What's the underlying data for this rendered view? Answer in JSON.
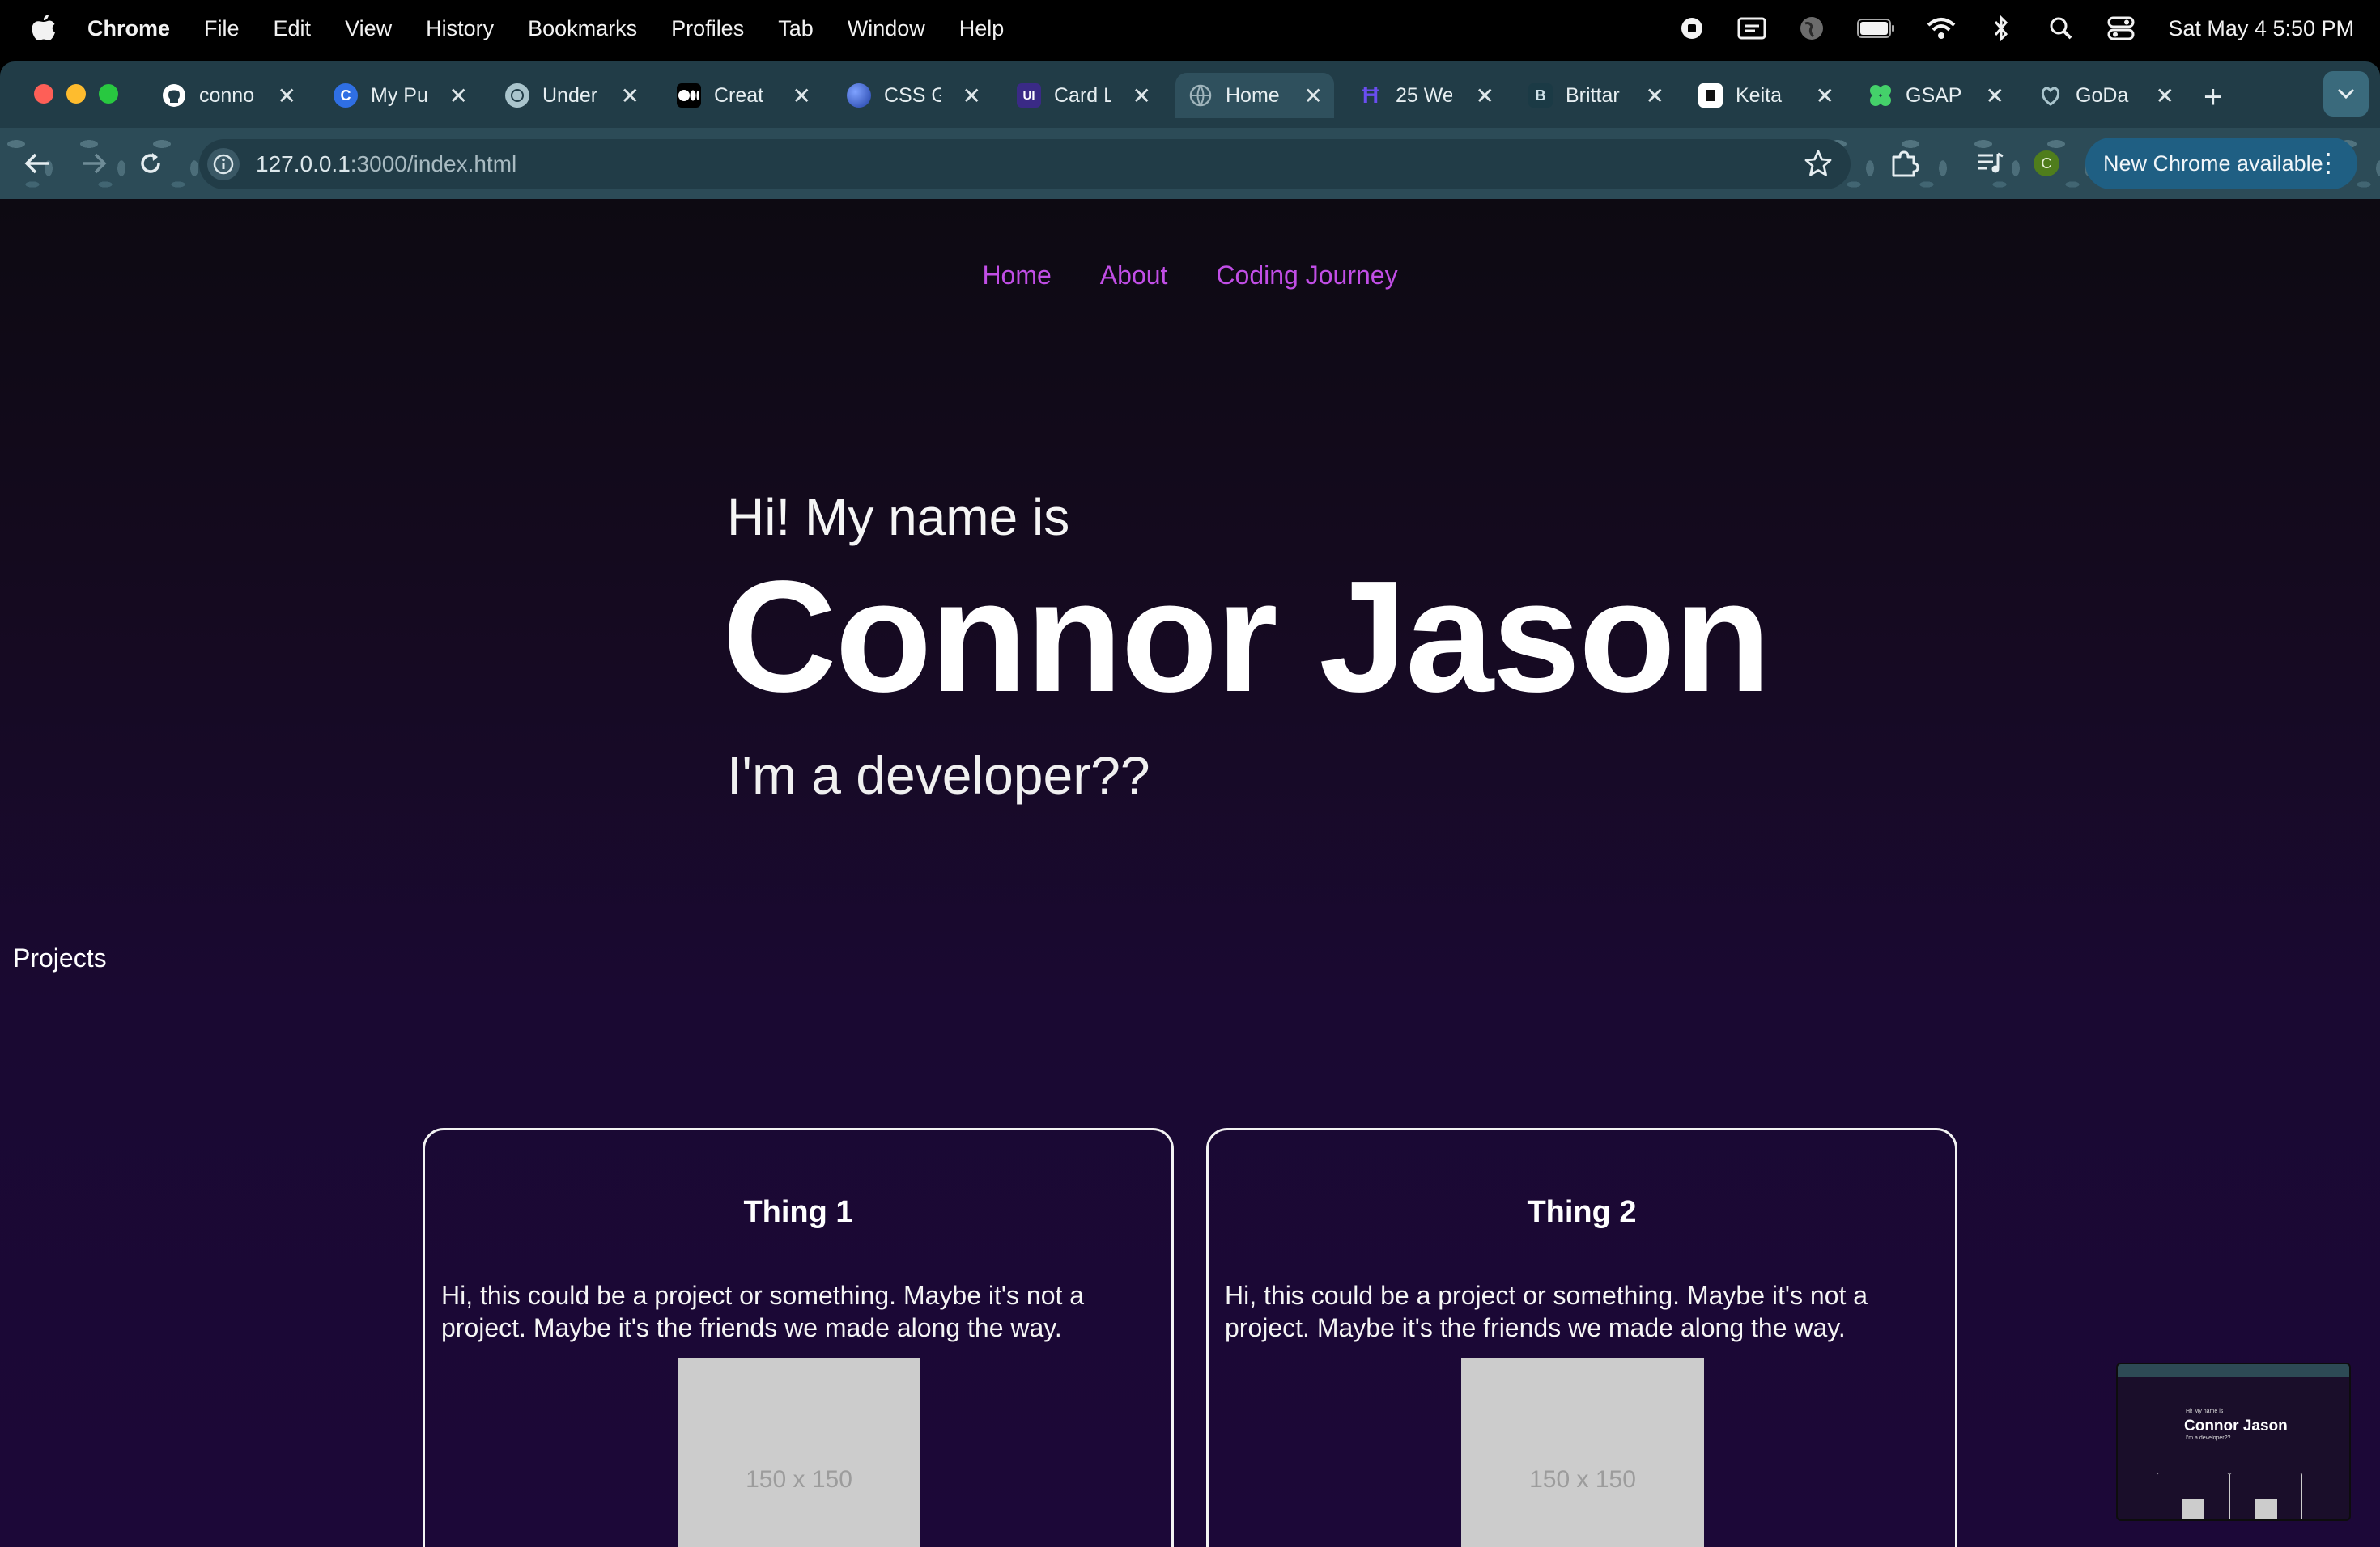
{
  "menubar": {
    "app_name": "Chrome",
    "items": [
      "File",
      "Edit",
      "View",
      "History",
      "Bookmarks",
      "Profiles",
      "Tab",
      "Window",
      "Help"
    ],
    "status_icons": [
      "record-icon",
      "display-icon",
      "globe-icon",
      "battery-icon",
      "wifi-icon",
      "bluetooth-icon",
      "spotlight-icon",
      "control-center-icon"
    ],
    "clock": "Sat May 4  5:50 PM"
  },
  "tabs": [
    {
      "label": "conno",
      "icon": "github-icon",
      "color": "#ffffff"
    },
    {
      "label": "My Pu",
      "icon": "c-logo-icon",
      "color": "#2f6fe4"
    },
    {
      "label": "Under",
      "icon": "openai-icon",
      "color": "#a9c4cc"
    },
    {
      "label": "Creat",
      "icon": "medium-icon",
      "color": "#ffffff"
    },
    {
      "label": "CSS G",
      "icon": "css-globe-icon",
      "color": "#3b6ad8"
    },
    {
      "label": "Card L",
      "icon": "ui-icon",
      "color": "#6a3fd8"
    },
    {
      "label": "Home",
      "icon": "globe-icon",
      "color": "#9fb4bb",
      "active": true
    },
    {
      "label": "25 We",
      "icon": "h-logo-icon",
      "color": "#6a4df0"
    },
    {
      "label": "Brittar",
      "icon": "b-logo-icon",
      "color": "#1b3a45"
    },
    {
      "label": "Keita",
      "icon": "keita-icon",
      "color": "#ffffff"
    },
    {
      "label": "GSAP",
      "icon": "gsap-icon",
      "color": "#44d16a"
    },
    {
      "label": "GoDa",
      "icon": "godaddy-icon",
      "color": "#a9c4cc"
    }
  ],
  "toolbar": {
    "url_host": "127.0.0.1",
    "url_path": ":3000/index.html",
    "new_chrome_label": "New Chrome available",
    "profile_initial": "C"
  },
  "site": {
    "nav": [
      "Home",
      "About",
      "Coding Journey"
    ],
    "nav_color": "#c14ee6",
    "greeting": "Hi! My name is",
    "name": "Connor Jason",
    "role": "I'm a developer??",
    "projects_heading": "Projects",
    "cards": [
      {
        "title": "Thing 1",
        "description": "Hi, this could be a project or something. Maybe it's not a project. Maybe it's the friends we made along the way.",
        "image_label": "150 x 150"
      },
      {
        "title": "Thing 2",
        "description": "Hi, this could be a project or something. Maybe it's not a project. Maybe it's the friends we made along the way.",
        "image_label": "150 x 150"
      }
    ]
  }
}
